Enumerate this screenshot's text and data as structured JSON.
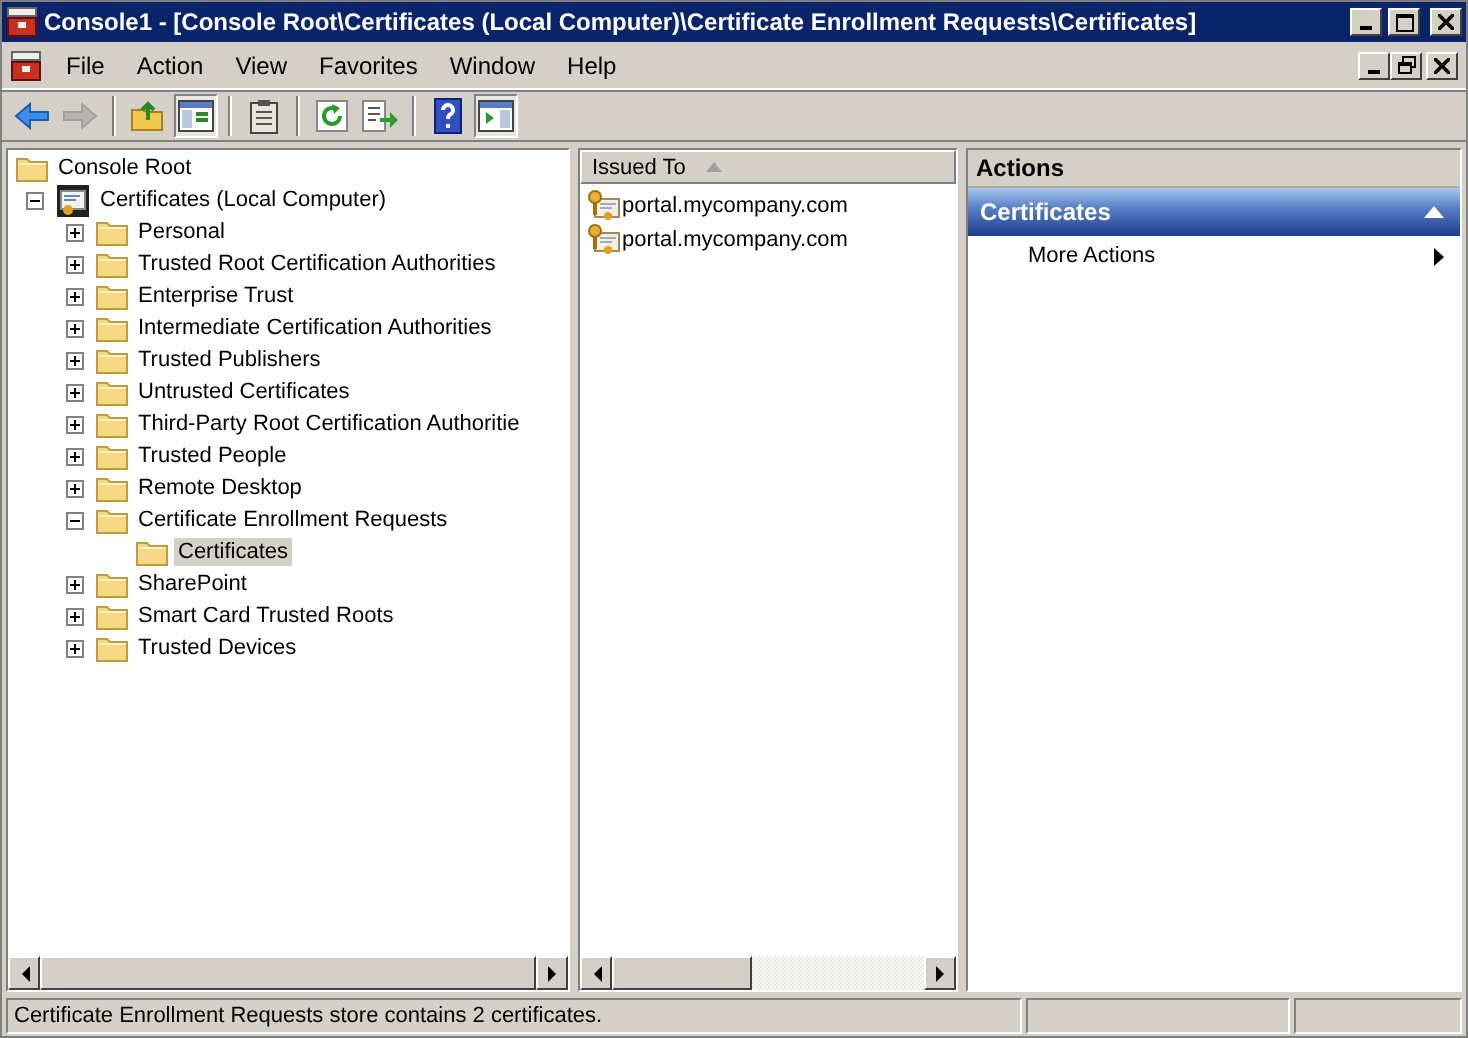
{
  "window": {
    "title": "Console1 - [Console Root\\Certificates (Local Computer)\\Certificate Enrollment Requests\\Certificates]"
  },
  "menu": [
    "File",
    "Action",
    "View",
    "Favorites",
    "Window",
    "Help"
  ],
  "toolbar": [
    {
      "kind": "back",
      "disabled": false,
      "pressed": false
    },
    {
      "kind": "forward",
      "disabled": true,
      "pressed": false
    },
    {
      "kind": "separator"
    },
    {
      "kind": "up",
      "disabled": false,
      "pressed": false
    },
    {
      "kind": "tree",
      "disabled": false,
      "pressed": true
    },
    {
      "kind": "separator"
    },
    {
      "kind": "clipboard",
      "disabled": false,
      "pressed": false
    },
    {
      "kind": "separator"
    },
    {
      "kind": "refresh",
      "disabled": false,
      "pressed": false
    },
    {
      "kind": "export",
      "disabled": false,
      "pressed": false
    },
    {
      "kind": "separator"
    },
    {
      "kind": "help",
      "disabled": false,
      "pressed": false
    },
    {
      "kind": "actionpane",
      "disabled": false,
      "pressed": true
    }
  ],
  "tree": [
    {
      "label": "Console Root",
      "kind": "folder",
      "selected": false
    },
    {
      "label": "Certificates (Local Computer)",
      "kind": "store",
      "selected": false,
      "expanded": true,
      "children": [
        {
          "label": "Personal",
          "kind": "folder",
          "selected": false,
          "expanded": false
        },
        {
          "label": "Trusted Root Certification Authorities",
          "kind": "folder",
          "selected": false,
          "expanded": false
        },
        {
          "label": "Enterprise Trust",
          "kind": "folder",
          "selected": false,
          "expanded": false
        },
        {
          "label": "Intermediate Certification Authorities",
          "kind": "folder",
          "selected": false,
          "expanded": false
        },
        {
          "label": "Trusted Publishers",
          "kind": "folder",
          "selected": false,
          "expanded": false
        },
        {
          "label": "Untrusted Certificates",
          "kind": "folder",
          "selected": false,
          "expanded": false
        },
        {
          "label": "Third-Party Root Certification Authoritie",
          "kind": "folder",
          "selected": false,
          "expanded": false
        },
        {
          "label": "Trusted People",
          "kind": "folder",
          "selected": false,
          "expanded": false
        },
        {
          "label": "Remote Desktop",
          "kind": "folder",
          "selected": false,
          "expanded": false
        },
        {
          "label": "Certificate Enrollment Requests",
          "kind": "folder",
          "selected": false,
          "expanded": true,
          "children": [
            {
              "label": "Certificates",
              "kind": "folder",
              "selected": true
            }
          ]
        },
        {
          "label": "SharePoint",
          "kind": "folder",
          "selected": false,
          "expanded": false
        },
        {
          "label": "Smart Card Trusted Roots",
          "kind": "folder",
          "selected": false,
          "expanded": false
        },
        {
          "label": "Trusted Devices",
          "kind": "folder",
          "selected": false,
          "expanded": false
        }
      ]
    }
  ],
  "list": {
    "columns": [
      {
        "label": "Issued To",
        "sorted": true
      }
    ],
    "rows": [
      {
        "cells": [
          "portal.mycompany.com"
        ],
        "selected": false
      },
      {
        "cells": [
          "portal.mycompany.com"
        ],
        "selected": false
      }
    ]
  },
  "actions": {
    "title": "Actions",
    "sections": [
      {
        "title": "Certificates",
        "expanded": true,
        "items": [
          {
            "label": "More Actions",
            "submenu": true
          }
        ]
      }
    ]
  },
  "status_bar": {
    "text": "Certificate Enrollment Requests store contains 2 certificates."
  }
}
